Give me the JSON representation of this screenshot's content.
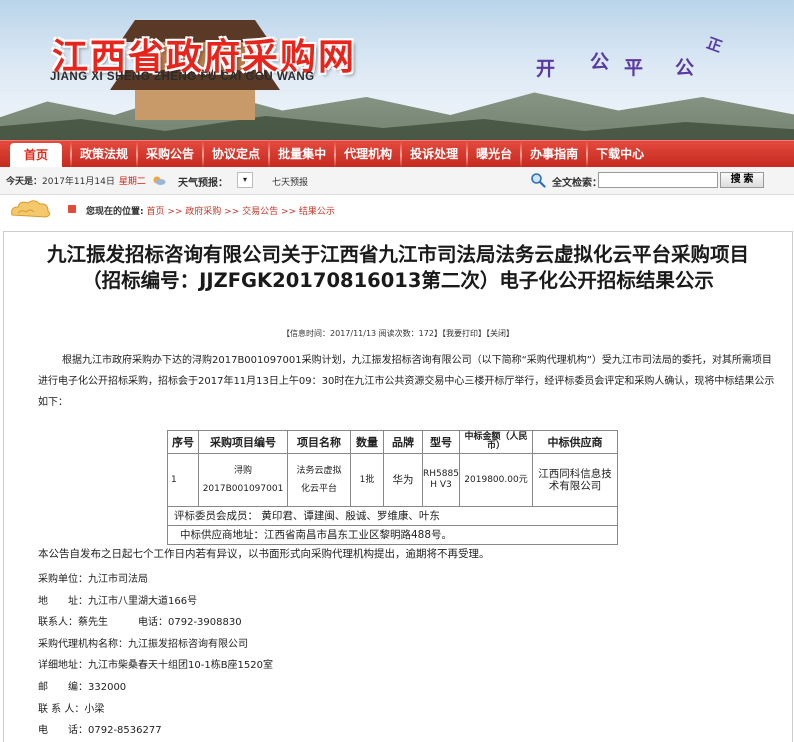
{
  "header": {
    "title": "江西省政府采购网",
    "pinyin": "JIANG XI SHENG ZHENG FU CAI GOU WANG",
    "slogan": [
      "开",
      "公",
      "平",
      "公",
      "正"
    ]
  },
  "nav": {
    "items": [
      {
        "label": "首页",
        "active": true
      },
      {
        "label": "政策法规"
      },
      {
        "label": "采购公告"
      },
      {
        "label": "协议定点"
      },
      {
        "label": "批量集中"
      },
      {
        "label": "代理机构"
      },
      {
        "label": "投诉处理"
      },
      {
        "label": "曝光台"
      },
      {
        "label": "办事指南"
      },
      {
        "label": "下载中心"
      }
    ]
  },
  "infobar": {
    "date_label": "今天是：",
    "date_value": "2017年11月14日",
    "weekday": "星期二",
    "weather_label": "天气预报：",
    "weather_box": "▾",
    "weather_forecast": "七天预报",
    "search_label": "全文检索：",
    "search_value": "",
    "search_button": "搜 索"
  },
  "breadcrumb": {
    "label": "您现在的位置:",
    "path": "首页 >> 政府采购 >> 交易公告 >> 结果公示"
  },
  "article": {
    "title_line1": "九江振发招标咨询有限公司关于江西省九江市司法局法务云虚拟化云平台采购项目",
    "title_line2": "（招标编号：JJZFGK20170816013第二次）电子化公开招标结果公示",
    "meta": "【信息时间：2017/11/13  阅读次数：172】【我要打印】【关闭】",
    "paragraph": "根据九江市政府采购办下达的浔购2017B001097001采购计划，九江振发招标咨询有限公司（以下简称“采购代理机构”）受九江市司法局的委托，对其所需项目进行电子化公开招标采购，招标会于2017年11月13日上午09：30时在九江市公共资源交易中心三楼开标厅举行，经评标委员会评定和采购人确认，现将中标结果公示如下：",
    "table": {
      "headers": [
        "序号",
        "采购项目编号",
        "项目名称",
        "数量",
        "品牌",
        "型号",
        "中标金额（人民币）",
        "中标供应商"
      ],
      "row": {
        "no": "1",
        "code_line1": "浔购",
        "code_line2": "2017B001097001",
        "name_line1": "法务云虚拟",
        "name_line2": "化云平台",
        "qty": "1批",
        "brand": "华为",
        "model_line1": "RH5885",
        "model_line2": "H V3",
        "amount": "2019800.00元",
        "supplier_line1": "江西同科信息技",
        "supplier_line2": "术有限公司"
      },
      "committee": "评标委员会成员：  黄印君、谭建闽、殷诚、罗维康、叶东",
      "address": "中标供应商地址：江西省南昌市昌东工业区黎明路488号。"
    },
    "notice": "本公告自发布之日起七个工作日内若有异议，以书面形式向采购代理机构提出，逾期将不再受理。",
    "contacts": [
      "采购单位：九江市司法局",
      "地　　址：九江市八里湖大道166号",
      "联系人：蔡先生　　　电话：0792-3908830",
      "采购代理机构名称：九江振发招标咨询有限公司",
      "详细地址：九江市柴桑春天十组团10-1栋B座1520室",
      "邮　　编：332000",
      "联 系 人：小梁",
      "电　　话：0792-8536277"
    ]
  }
}
